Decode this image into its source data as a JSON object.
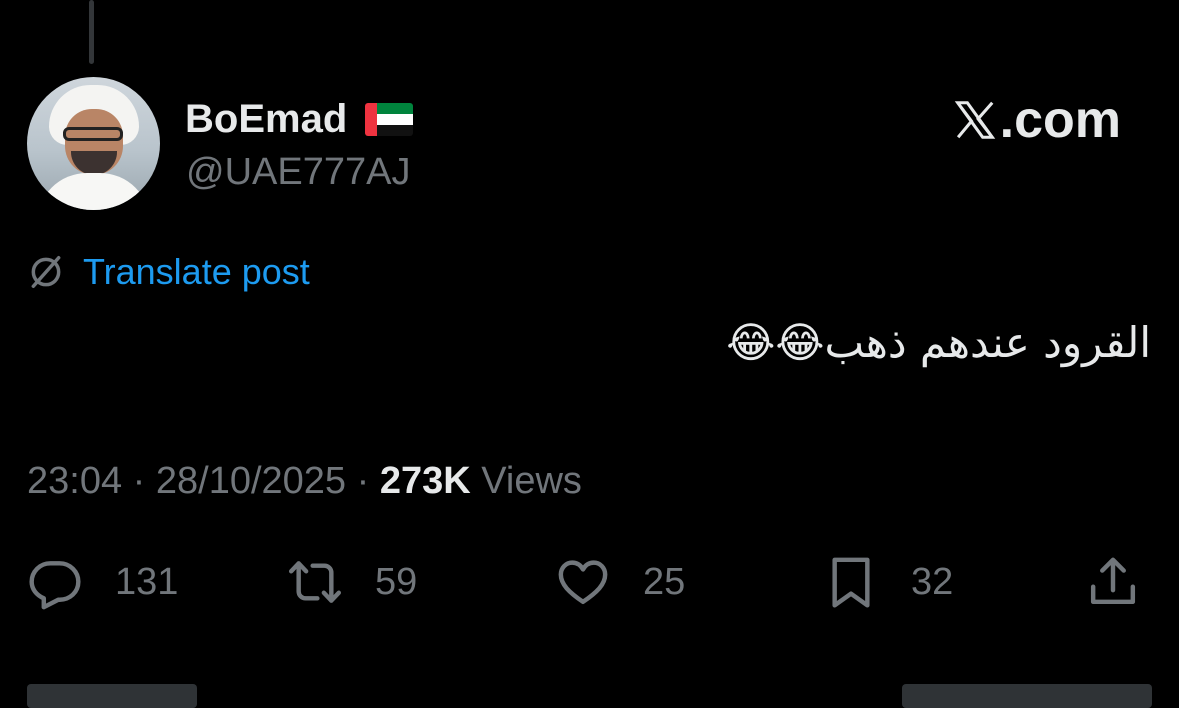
{
  "author": {
    "display_name": "BoEmad",
    "handle": "@UAE777AJ",
    "flag": "UAE flag",
    "avatar": "profile-photo"
  },
  "watermark": {
    "text": ".com",
    "logo": "x-logo"
  },
  "translate": {
    "label": "Translate post",
    "icon": "translate-icon"
  },
  "post": {
    "text": "القرود عندهم ذهب😂😂"
  },
  "meta": {
    "time": "23:04",
    "separator1": " · ",
    "date": "28/10/2025",
    "separator2": " · ",
    "views_count": "273K",
    "views_label": " Views"
  },
  "actions": {
    "reply": {
      "icon": "reply-icon",
      "count": "131"
    },
    "repost": {
      "icon": "repost-icon",
      "count": "59"
    },
    "like": {
      "icon": "heart-icon",
      "count": "25"
    },
    "bookmark": {
      "icon": "bookmark-icon",
      "count": "32"
    },
    "share": {
      "icon": "share-icon"
    }
  },
  "colors": {
    "background": "#000000",
    "primary_text": "#e7e9ea",
    "secondary_text": "#71767b",
    "link": "#1d9bf0"
  }
}
